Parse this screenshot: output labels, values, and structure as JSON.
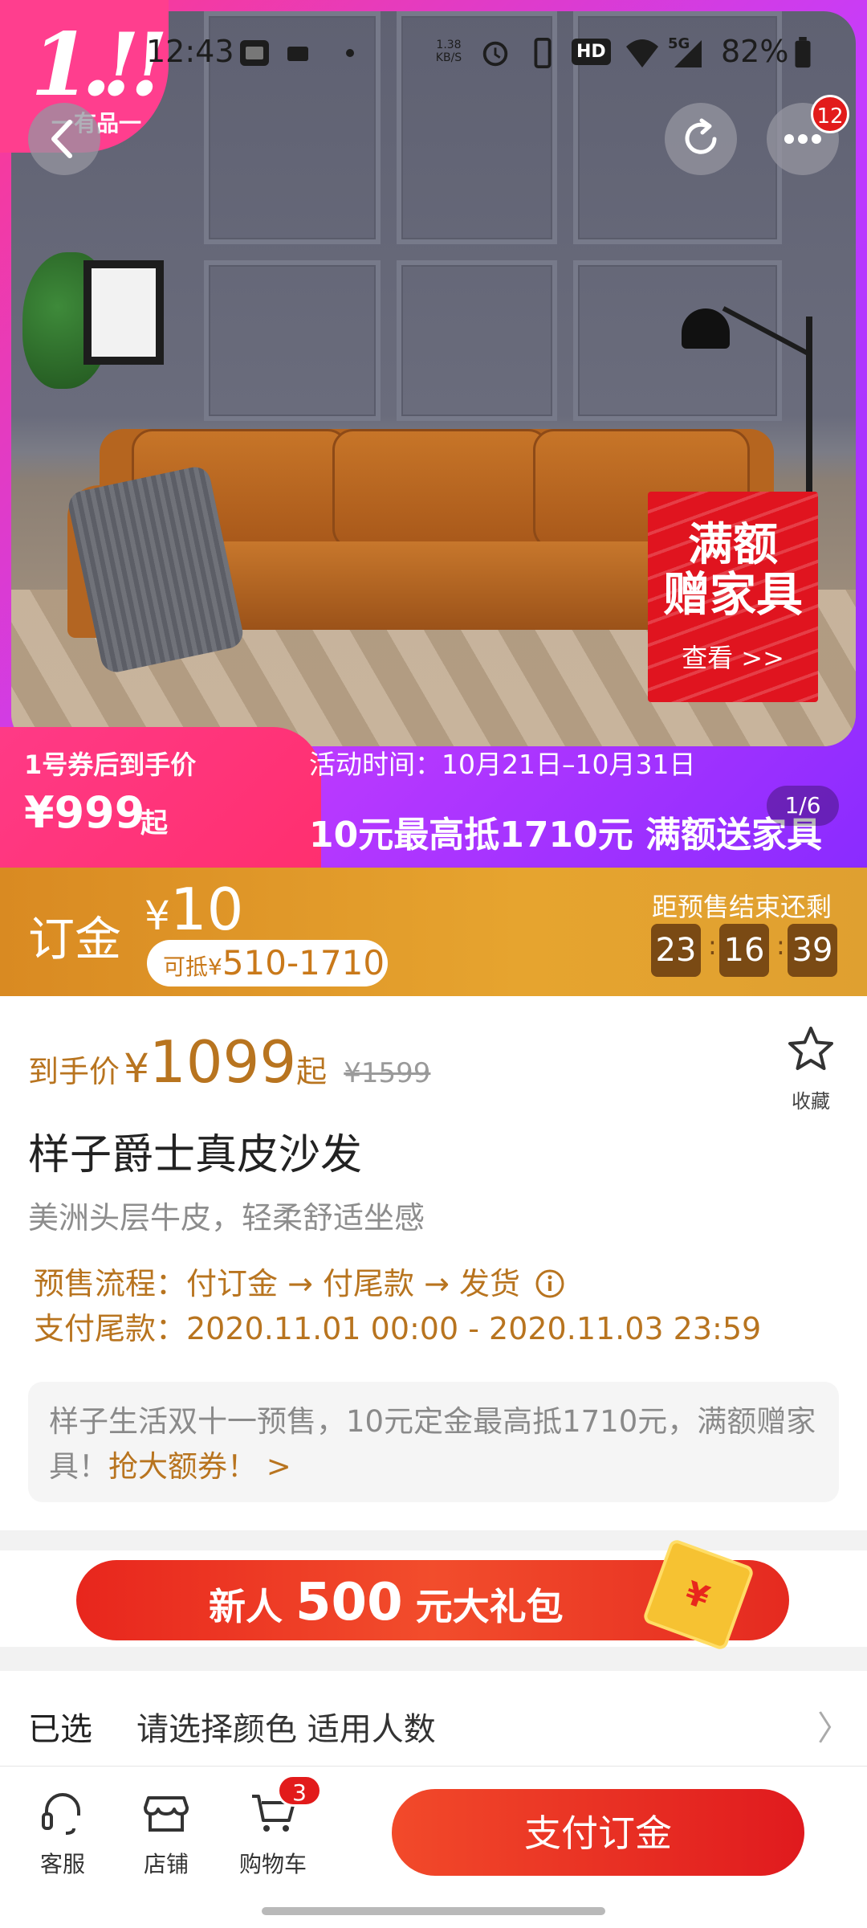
{
  "status_bar": {
    "time": "12:43",
    "net_speed": "1.38 KB/S",
    "battery": "82%",
    "network": "5G",
    "hd": "HD"
  },
  "brand": {
    "mark": "1.!!",
    "sub": "一有品一"
  },
  "nav": {
    "more_badge": "12"
  },
  "hero": {
    "promo_badge": {
      "line1": "满额",
      "line2": "赠家具",
      "line3": "查看 >>"
    },
    "price_caption": "1号券后到手价",
    "price": "¥999",
    "price_suffix": "起",
    "activity_time": "活动时间：10月21日–10月31日",
    "activity_slogan": "10元最高抵1710元 满额送家具",
    "page_indicator": "1/6"
  },
  "deposit": {
    "label": "订金",
    "currency": "¥",
    "amount": "10",
    "offset_prefix": "可抵¥",
    "offset_range": "510-1710",
    "countdown_label": "距预售结束还剩",
    "countdown": [
      "23",
      "16",
      "39"
    ]
  },
  "product": {
    "price_prefix": "到手价",
    "currency": "¥",
    "price": "1099",
    "price_suffix": "起",
    "original_price": "¥1599",
    "favorite_label": "收藏",
    "title": "样子爵士真皮沙发",
    "subtitle": "美洲头层牛皮，轻柔舒适坐感",
    "presale_flow": "预售流程：付订金 → 付尾款 → 发货",
    "balance_payment": "支付尾款：2020.11.01 00:00 - 2020.11.03 23:59",
    "notice_text": "样子生活双十一预售，10元定金最高抵1710元，满额赠家具！",
    "notice_link": "抢大额券！ >"
  },
  "gift_banner": {
    "pre": "新人",
    "amount": "500",
    "post": "元大礼包"
  },
  "selection": {
    "key": "已选",
    "value": "请选择颜色 适用人数",
    "arrow": "〉"
  },
  "bottom_bar": {
    "service": "客服",
    "shop": "店铺",
    "cart": "购物车",
    "cart_badge": "3",
    "pay_button": "支付订金"
  },
  "colors": {
    "accent_red": "#e01a1e",
    "gold": "#b8741f",
    "deposit_bg": "#e0a030",
    "hero_pink": "#ff3a8c",
    "hero_purple": "#8a2bff"
  }
}
